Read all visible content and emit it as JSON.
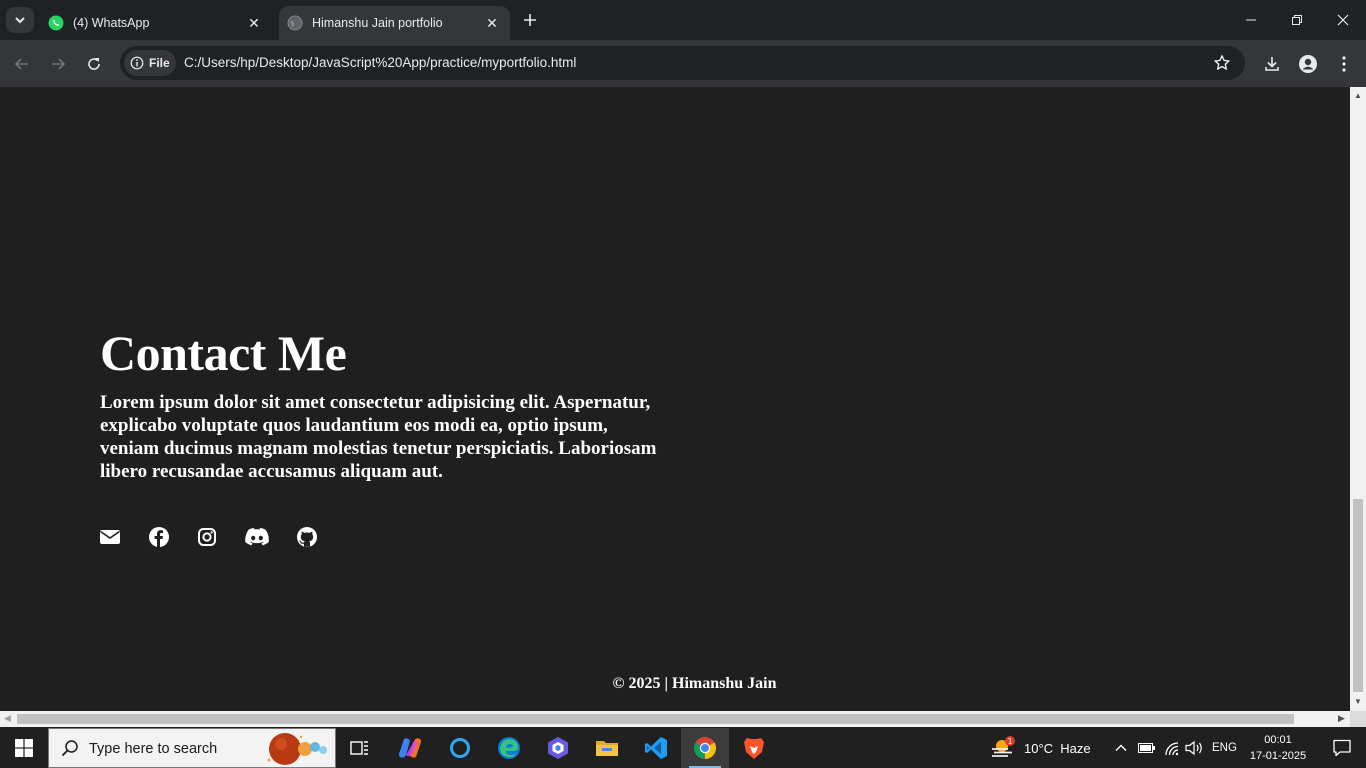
{
  "browser": {
    "tabs": [
      {
        "title": "(4) WhatsApp",
        "active": false,
        "icon": "whatsapp-icon"
      },
      {
        "title": "Himanshu Jain portfolio",
        "active": true,
        "icon": "globe-icon"
      }
    ],
    "address_chip": "File",
    "url": "C:/Users/hp/Desktop/JavaScript%20App/practice/myportfolio.html"
  },
  "page": {
    "contact": {
      "heading": "Contact Me",
      "body": "Lorem ipsum dolor sit amet consectetur adipisicing elit. Aspernatur, explicabo voluptate quos laudantium eos modi ea, optio ipsum, veniam ducimus magnam molestias tenetur perspiciatis. Laboriosam libero recusandae accusamus aliquam aut."
    },
    "socials": [
      "envelope-icon",
      "facebook-icon",
      "instagram-icon",
      "discord-icon",
      "github-icon"
    ],
    "footer": "© 2025 | Himanshu Jain",
    "background_color": "#1f1f1f"
  },
  "taskbar": {
    "search_placeholder": "Type here to search",
    "weather": "10°C  Haze",
    "weather_badge": "1",
    "language": "ENG",
    "time": "00:01",
    "date": "17-01-2025"
  }
}
